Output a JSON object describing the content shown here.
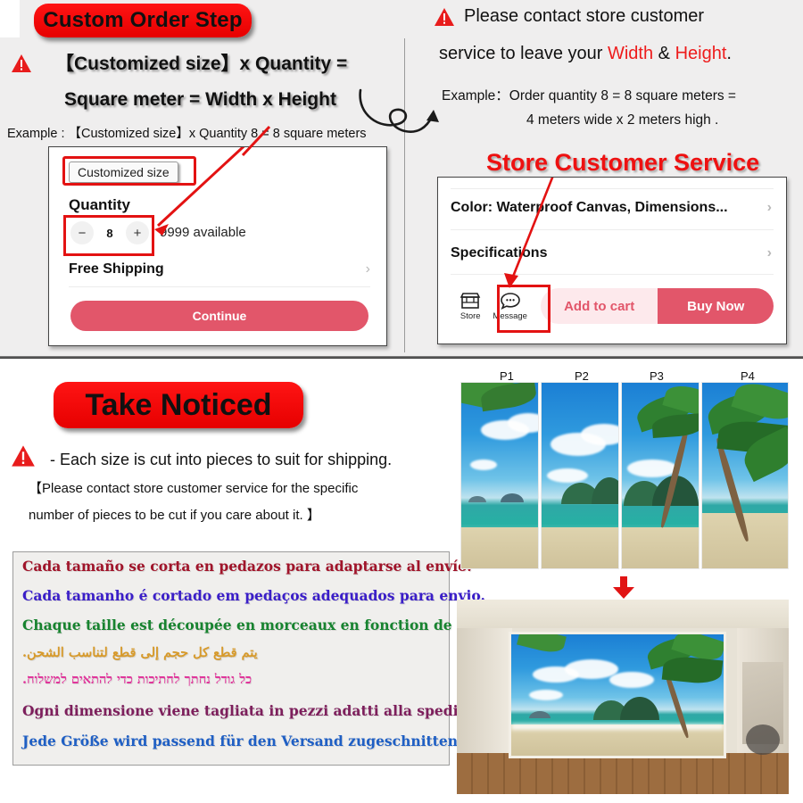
{
  "top_left": {
    "badge": "Custom Order Step",
    "headline_line1": "【Customized size】x Quantity =",
    "headline_line2": "Square meter = Width x Height",
    "example": "Example :  【Customized size】x Quantity 8 = 8 square meters",
    "warn_icon": "warning-triangle-icon",
    "swirl_icon": "curved-arrow-icon"
  },
  "product_card": {
    "customized_size_chip": "Customized size",
    "quantity_label": "Quantity",
    "minus": "−",
    "quantity_value": "8",
    "plus": "+",
    "available": "9999 available",
    "free_shipping": "Free Shipping",
    "chevron": "›",
    "continue": "Continue"
  },
  "top_right": {
    "line1": "Please contact store customer",
    "line2_pre": "service to leave your ",
    "line2_width": "Width",
    "line2_amp": " & ",
    "line2_height": "Height",
    "line2_end": ".",
    "example_line1": "Example：Order quantity 8 = 8 square meters =",
    "example_line2": "4 meters wide x 2 meters high .",
    "store_cs_title": "Store Customer Service"
  },
  "store_card": {
    "color_row": "Color: Waterproof Canvas, Dimensions...",
    "spec_row": "Specifications",
    "chevron": "›",
    "store_label": "Store",
    "message_label": "Message",
    "add_to_cart": "Add to cart",
    "buy_now": "Buy Now"
  },
  "bottom": {
    "badge": "Take Noticed",
    "notice_1": "- Each size is cut into pieces to suit for shipping.",
    "notice_2": "【Please contact store customer service for the specific",
    "notice_3": "number of pieces to be cut if you care about it. 】",
    "languages": [
      {
        "text": "Cada tamaño se corta en pedazos para adaptarse al envío.",
        "color": "#a0142a",
        "rtl": false
      },
      {
        "text": "Cada tamanho é cortado em pedaços adequados para envio.",
        "color": "#3a1ec8",
        "rtl": false
      },
      {
        "text": "Chaque taille est découpée en morceaux en fonction de l'expédition.",
        "color": "#17832f",
        "rtl": false
      },
      {
        "text": "يتم قطع كل حجم إلى قطع لتناسب الشحن.",
        "color": "#d79a2b",
        "rtl": true
      },
      {
        "text": "כל גודל נחתך לחתיכות כדי להתאים למשלוח.",
        "color": "#e0369b",
        "rtl": true
      },
      {
        "text": "Ogni dimensione viene tagliata in pezzi adatti alla spedizione.",
        "color": "#7d1f5c",
        "rtl": false
      },
      {
        "text": "Jede Größe wird passend für den Versand zugeschnitten.",
        "color": "#1f5fc4",
        "rtl": false
      }
    ]
  },
  "preview": {
    "panel_labels": [
      "P1",
      "P2",
      "P3",
      "P4"
    ],
    "down_arrow_icon": "down-arrow-icon",
    "panels_alt": "beach-panels-preview",
    "room_alt": "room-mockup-preview"
  },
  "colors": {
    "badge_red": "#ff1414",
    "accent_red": "#e31212",
    "brand_pink": "#e2566a",
    "panel_bg": "#efeeee"
  }
}
